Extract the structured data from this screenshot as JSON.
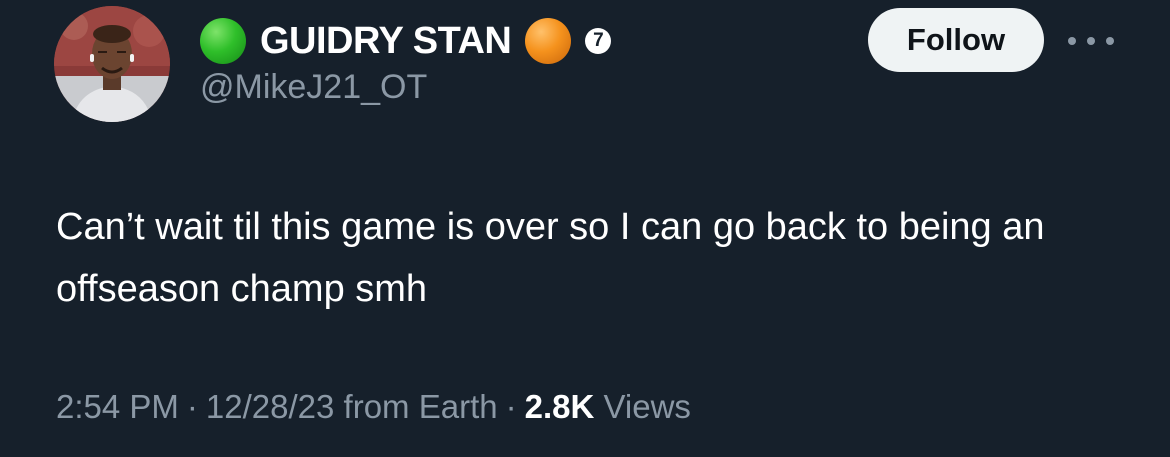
{
  "author": {
    "display_name": "GUIDRY STAN",
    "handle": "@MikeJ21_OT",
    "badge_number": "7",
    "status_colors": {
      "left_dot": "#2fbf2a",
      "right_dot": "#f5921d"
    }
  },
  "actions": {
    "follow_label": "Follow",
    "more_icon": "more-horizontal-icon"
  },
  "tweet": {
    "text": "Can’t wait til this game is over so I can go back to being an offseason champ smh"
  },
  "meta": {
    "time": "2:54 PM",
    "separator": "·",
    "date": "12/28/23",
    "source": "from Earth",
    "views_count": "2.8K",
    "views_label": "Views"
  },
  "colors": {
    "background": "#16202b",
    "text_primary": "#ffffff",
    "text_secondary": "#8b98a5",
    "follow_bg": "#eff3f4"
  }
}
